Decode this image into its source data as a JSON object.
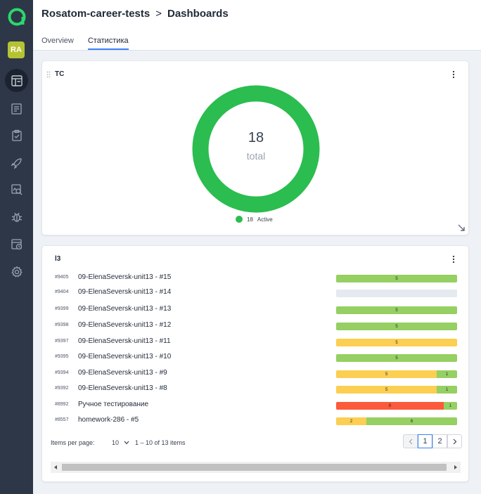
{
  "sidebar": {
    "avatar": "RA",
    "icons": [
      "dashboards-icon",
      "launches-icon",
      "test-cases-icon",
      "deploy-icon",
      "analytics-icon",
      "defects-icon",
      "jobs-icon",
      "settings-icon"
    ]
  },
  "header": {
    "project": "Rosatom-career-tests",
    "separator": ">",
    "page": "Dashboards",
    "tabs": [
      "Overview",
      "Статистика"
    ],
    "active_tab": "Статистика"
  },
  "tc_widget": {
    "title": "TC",
    "total": "18",
    "total_label": "total",
    "legend": [
      {
        "count": "18",
        "label": "Active",
        "color": "#2bbd4f"
      }
    ]
  },
  "launches_widget": {
    "title": "l3",
    "colors": {
      "green": "#96cf62",
      "yellow": "#fcce51",
      "red": "#fb5a3c",
      "empty": "#e5e9f0"
    },
    "rows": [
      {
        "id": "#9405",
        "name": "09-ElenaSeversk-unit13 - #15",
        "segments": [
          {
            "color": "green",
            "count": 5
          }
        ]
      },
      {
        "id": "#9404",
        "name": "09-ElenaSeversk-unit13 - #14",
        "segments": []
      },
      {
        "id": "#9399",
        "name": "09-ElenaSeversk-unit13 - #13",
        "segments": [
          {
            "color": "green",
            "count": 5
          }
        ]
      },
      {
        "id": "#9398",
        "name": "09-ElenaSeversk-unit13 - #12",
        "segments": [
          {
            "color": "green",
            "count": 5
          }
        ]
      },
      {
        "id": "#9397",
        "name": "09-ElenaSeversk-unit13 - #11",
        "segments": [
          {
            "color": "yellow",
            "count": 5
          }
        ]
      },
      {
        "id": "#9395",
        "name": "09-ElenaSeversk-unit13 - #10",
        "segments": [
          {
            "color": "green",
            "count": 5
          }
        ]
      },
      {
        "id": "#9394",
        "name": "09-ElenaSeversk-unit13 - #9",
        "segments": [
          {
            "color": "yellow",
            "count": 5
          },
          {
            "color": "green",
            "count": 1
          }
        ]
      },
      {
        "id": "#9392",
        "name": "09-ElenaSeversk-unit13 - #8",
        "segments": [
          {
            "color": "yellow",
            "count": 5
          },
          {
            "color": "green",
            "count": 1
          }
        ]
      },
      {
        "id": "#8992",
        "name": "Ручное тестирование",
        "segments": [
          {
            "color": "red",
            "count": 8
          },
          {
            "color": "green",
            "count": 1
          }
        ]
      },
      {
        "id": "#8557",
        "name": "homework-286 - #5",
        "segments": [
          {
            "color": "yellow",
            "count": 2
          },
          {
            "color": "green",
            "count": 6
          }
        ]
      }
    ],
    "pagination": {
      "items_per_page_label": "Items per page:",
      "items_per_page": "10",
      "range": "1 – 10 of 13 items",
      "pages": [
        "1",
        "2"
      ],
      "current_page": "1"
    }
  }
}
